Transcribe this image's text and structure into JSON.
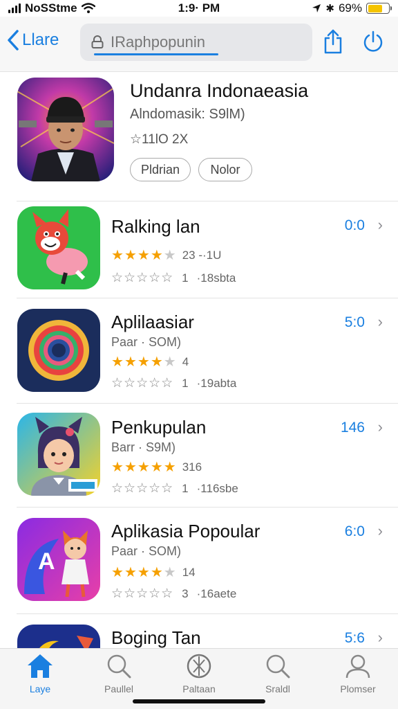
{
  "status_bar": {
    "carrier": "NoSStme",
    "time": "1:9· PM",
    "battery": "69%",
    "battery_level": 0.69
  },
  "nav": {
    "back_label": "Llare",
    "search_text": "IRaphpopunin"
  },
  "featured": {
    "title": "Undanra Indonaeasia",
    "subtitle": "Alndomasik: S9lM)",
    "rating": "☆11lO 2X",
    "pill_1": "Pldrian",
    "pill_2": "Nolor"
  },
  "apps": [
    {
      "title": "Ralking lan",
      "subtitle": "",
      "stars_filled": 3.5,
      "rating_text": "23 -·1U",
      "review_count": "1",
      "review_text": "·18sbta",
      "price": "0:0"
    },
    {
      "title": "Aplilaasiar",
      "subtitle": "Paar · SOM)",
      "stars_filled": 3.5,
      "rating_text": "4",
      "review_count": "1",
      "review_text": "·19abta",
      "price": "5:0"
    },
    {
      "title": "Penkupulan",
      "subtitle": "Barr · S9M)",
      "stars_filled": 4.5,
      "rating_text": "316",
      "review_count": "1",
      "review_text": "·116sbe",
      "price": "146"
    },
    {
      "title": "Aplikasia Popoular",
      "subtitle": "Paar · SOM)",
      "stars_filled": 4,
      "rating_text": "14",
      "review_count": "3",
      "review_text": "·16aete",
      "price": "6:0"
    },
    {
      "title": "Boging Tan",
      "subtitle": "",
      "stars_filled": 0,
      "rating_text": "",
      "review_count": "",
      "review_text": "",
      "price": "5:6"
    }
  ],
  "tabs": [
    {
      "label": "Laye",
      "icon": "home-icon",
      "active": true
    },
    {
      "label": "Paullel",
      "icon": "search-icon",
      "active": false
    },
    {
      "label": "Paltaan",
      "icon": "compass-icon",
      "active": false
    },
    {
      "label": "Sraldl",
      "icon": "search-icon",
      "active": false
    },
    {
      "label": "Plomser",
      "icon": "profile-icon",
      "active": false
    }
  ],
  "colors": {
    "accent": "#1a7fe0",
    "star": "#f5a000",
    "battery": "#f5c400"
  }
}
